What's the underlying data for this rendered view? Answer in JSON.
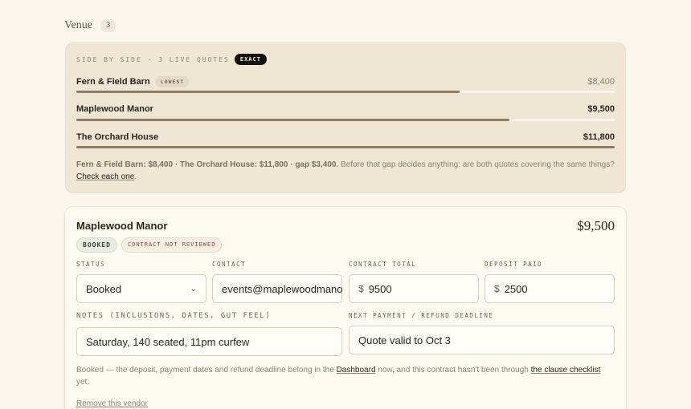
{
  "section": {
    "title": "Venue",
    "count": "3"
  },
  "comparison": {
    "header": "SIDE BY SIDE · 3 LIVE QUOTES",
    "badge": "EXACT",
    "rows": [
      {
        "name": "Fern & Field Barn",
        "tag": "LOWEST",
        "price": "$8,400",
        "fraction": 0.712
      },
      {
        "name": "Maplewood Manor",
        "tag": "",
        "price": "$9,500",
        "fraction": 0.805
      },
      {
        "name": "The Orchard House",
        "tag": "",
        "price": "$11,800",
        "fraction": 1.0
      }
    ],
    "note_bold": "Fern & Field Barn: $8,400 · The Orchard House: $11,800 · gap $3,400.",
    "note_text": " Before that gap decides anything: are both quotes covering the same things? ",
    "note_link": "Check each one",
    "note_end": ".",
    "accent_color": "#8d7e63"
  },
  "vendor": {
    "name": "Maplewood Manor",
    "price": "$9,500",
    "badges": {
      "status": "BOOKED",
      "warning": "CONTRACT NOT REVIEWED"
    },
    "fields": {
      "status": {
        "label": "STATUS",
        "value": "Booked"
      },
      "contact": {
        "label": "CONTACT",
        "value": "events@maplewoodmanor.com"
      },
      "contract_total": {
        "label": "CONTRACT TOTAL",
        "currency": "$",
        "value": "9500"
      },
      "deposit_paid": {
        "label": "DEPOSIT PAID",
        "currency": "$",
        "value": "2500"
      },
      "notes": {
        "label": "NOTES (INCLUSIONS, DATES, GUT FEEL)",
        "value": "Saturday, 140 seated, 11pm curfew"
      },
      "deadline": {
        "label": "NEXT PAYMENT / REFUND DEADLINE",
        "value": "Quote valid to Oct 3"
      }
    },
    "note_pre": "Booked — the deposit, payment dates and refund deadline belong in the ",
    "note_link1": "Dashboard",
    "note_mid": " now, and this contract hasn't been through ",
    "note_link2": "the clause checklist",
    "note_post": " yet.",
    "remove_label": "Remove this vendor"
  }
}
